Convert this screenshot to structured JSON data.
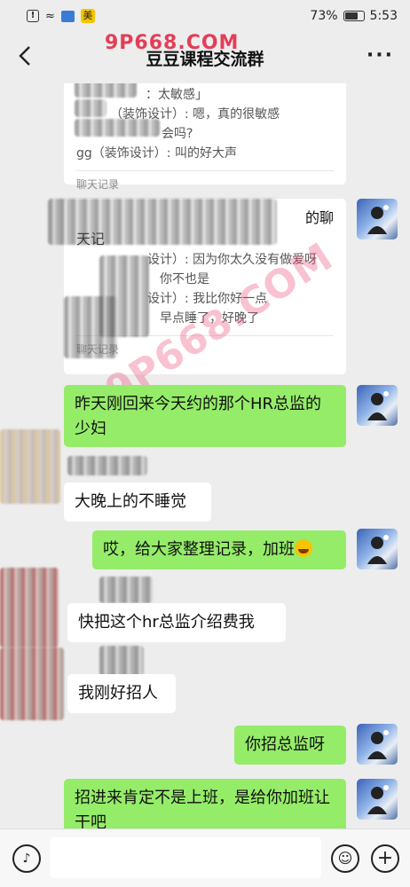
{
  "status_bar": {
    "battery_percent": "73%",
    "time": "5:53",
    "app_badge": "美",
    "battery_level": 0.73
  },
  "nav": {
    "title": "豆豆课程交流群",
    "back_icon": "back-chevron-icon",
    "more_icon": "more-dots-icon"
  },
  "watermarks": [
    "9P668.COM",
    "9P668.COM"
  ],
  "chat_records": [
    {
      "lines": [
        "：太敏感」",
        "（装饰设计）: 嗯，真的很敏感",
        "会吗?",
        "gg（装饰设计）: 叫的好大声"
      ],
      "footer": "聊天记录"
    },
    {
      "title_tail": "的聊",
      "title_line2": "天记",
      "lines": [
        "设计）: 因为你太久没有做爱呀",
        "你不也是",
        "设计）: 我比你好一点",
        "早点睡了，好晚了"
      ],
      "footer": "聊天记录"
    }
  ],
  "messages": [
    {
      "side": "right",
      "text": "昨天刚回来今天约的那个HR总监的少妇"
    },
    {
      "side": "left",
      "text": "大晚上的不睡觉"
    },
    {
      "side": "right",
      "text": "哎，给大家整理记录，加班",
      "emoji": "grinning-sweat-emoji"
    },
    {
      "side": "left",
      "text": "快把这个hr总监介绍费我"
    },
    {
      "side": "left",
      "text": "我刚好招人"
    },
    {
      "side": "right",
      "text": "你招总监呀"
    },
    {
      "side": "right",
      "text": "招进来肯定不是上班，是给你加班让干吧"
    }
  ],
  "input_bar": {
    "voice_icon": "voice-icon",
    "emoji_icon": "emoji-icon",
    "plus_icon": "plus-icon"
  }
}
